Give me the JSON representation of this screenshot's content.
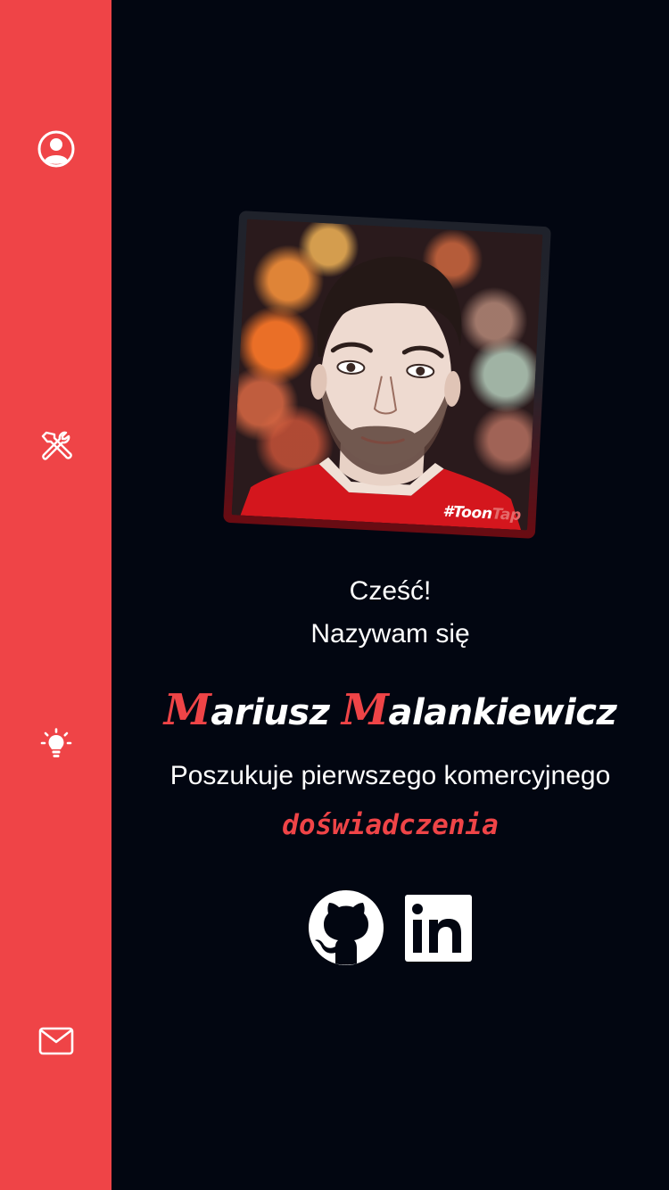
{
  "sidebar": {
    "accent_color": "#ef4447",
    "items": [
      {
        "name": "profile",
        "icon": "user-circle-icon"
      },
      {
        "name": "skills",
        "icon": "tools-icon"
      },
      {
        "name": "projects",
        "icon": "lightbulb-icon"
      },
      {
        "name": "contact",
        "icon": "envelope-icon"
      }
    ]
  },
  "hero": {
    "photo_watermark_a": "#Toon",
    "photo_watermark_b": "Tap",
    "greeting_line1": "Cześć!",
    "greeting_line2": "Nazywam się",
    "first_initial": "M",
    "first_rest": "ariusz",
    "last_initial": "M",
    "last_rest": "alankiewicz",
    "tagline": "Poszukuje pierwszego komercyjnego",
    "highlight": "doświadczenia"
  },
  "social": [
    {
      "name": "github",
      "icon": "github-icon"
    },
    {
      "name": "linkedin",
      "icon": "linkedin-icon"
    }
  ],
  "colors": {
    "background": "#020611",
    "accent": "#ef4447",
    "text": "#ffffff"
  }
}
